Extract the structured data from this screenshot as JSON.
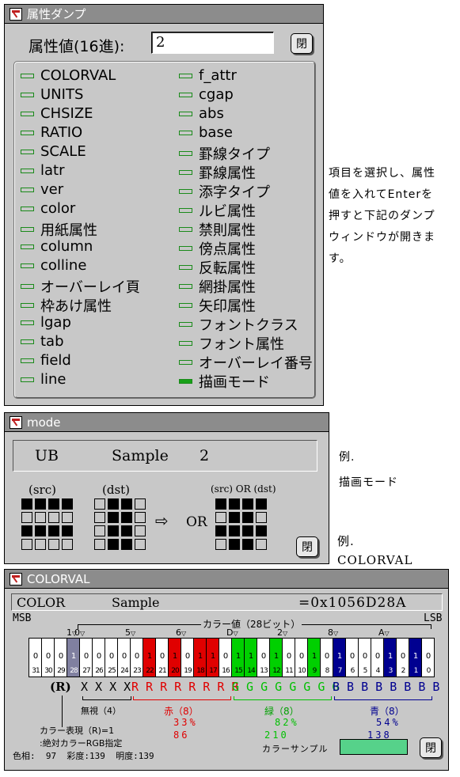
{
  "attr_window": {
    "title": "属性ダンプ",
    "value_label": "属性値(16進):",
    "value": "2",
    "close": "閉",
    "items_left": [
      "COLORVAL",
      "UNITS",
      "CHSIZE",
      "RATIO",
      "SCALE",
      "latr",
      "ver",
      "color",
      "用紙属性",
      "column",
      "colline",
      "オーバーレイ頁",
      "枠あけ属性",
      "lgap",
      "tab",
      "field",
      "line"
    ],
    "items_right": [
      "f_attr",
      "cgap",
      "abs",
      "base",
      "罫線タイプ",
      "罫線属性",
      "添字タイプ",
      "ルビ属性",
      "禁則属性",
      "傍点属性",
      "反転属性",
      "網掛属性",
      "矢印属性",
      "フォントクラス",
      "フォント属性",
      "オーバーレイ番号",
      "描画モード"
    ],
    "active_item": "描画モード"
  },
  "side_note": [
    "項目を選択し、属性",
    "値を入れてEnterを",
    "押すと下記のダンプ",
    "ウィンドウが開きま",
    "す。"
  ],
  "mode_window": {
    "title": "mode",
    "field1": "UB",
    "field2": "Sample",
    "field3": "2",
    "src_label": "(src)",
    "dst_label": "(dst)",
    "arrow": "⇨",
    "or_label": "OR",
    "result_label": "(src) OR (dst)",
    "close": "閉",
    "src_pattern": [
      [
        1,
        1,
        1,
        1
      ],
      [
        0,
        0,
        0,
        0
      ],
      [
        1,
        1,
        1,
        1
      ],
      [
        0,
        0,
        0,
        0
      ]
    ],
    "dst_pattern": [
      [
        0,
        1,
        1,
        0
      ],
      [
        0,
        1,
        1,
        0
      ],
      [
        0,
        1,
        1,
        0
      ],
      [
        0,
        1,
        1,
        0
      ]
    ],
    "result_pattern": [
      [
        1,
        1,
        1,
        1
      ],
      [
        0,
        1,
        1,
        0
      ],
      [
        1,
        1,
        1,
        1
      ],
      [
        0,
        1,
        1,
        0
      ]
    ]
  },
  "example1": {
    "label": "例.",
    "text": "描画モード"
  },
  "example2": {
    "label": "例.",
    "text": "COLORVAL"
  },
  "color_window": {
    "title": "COLORVAL",
    "header_name": "COLOR",
    "header_sample": "Sample",
    "header_value": "=0x1056D28A",
    "msb": "MSB",
    "lsb": "LSB",
    "bits_caption": "カラー値（28ビット）",
    "hex_digits": [
      "1",
      "0",
      "5",
      "6",
      "D",
      "2",
      "8",
      "A"
    ],
    "bit_values": [
      "0",
      "0",
      "0",
      "1",
      "0",
      "0",
      "0",
      "0",
      "0",
      "1",
      "0",
      "1",
      "0",
      "1",
      "1",
      "0",
      "1",
      "1",
      "0",
      "1",
      "0",
      "0",
      "1",
      "0",
      "1",
      "0",
      "0",
      "0",
      "1",
      "0",
      "1",
      "0"
    ],
    "bit_numbers": [
      "31",
      "30",
      "29",
      "28",
      "27",
      "26",
      "25",
      "24",
      "23",
      "22",
      "21",
      "20",
      "19",
      "18",
      "17",
      "16",
      "15",
      "14",
      "13",
      "12",
      "11",
      "10",
      "9",
      "8",
      "7",
      "6",
      "5",
      "4",
      "3",
      "2",
      "1",
      "0"
    ],
    "r_flag": "(R)",
    "ignore_letters": "X X X X",
    "red_letters": "R R R R R R R R",
    "green_letters": "G G G G G G G G",
    "blue_letters": "B B B B B B B B",
    "ignore_label": "無視（4）",
    "red_label": "赤（8）",
    "red_pct": "33%",
    "red_val": "86",
    "green_label": "緑（8）",
    "green_pct": "82%",
    "green_val": "210",
    "blue_label": "青（8）",
    "blue_pct": "54%",
    "blue_val": "138",
    "r_note1": "カラー表現（R)=1",
    "r_note2": ":絶対カラーRGB指定",
    "hsv": "色相:  97  彩度:139  明度:139",
    "sample_label": "カラーサンプル",
    "sample_color": "#56D28A",
    "close": "閉"
  },
  "colors": {
    "red": "#e00000",
    "green": "#00d000",
    "blue": "#000090",
    "gray": "#8080a0",
    "title": "#8c8c8c",
    "panel": "#c8c8c8"
  }
}
